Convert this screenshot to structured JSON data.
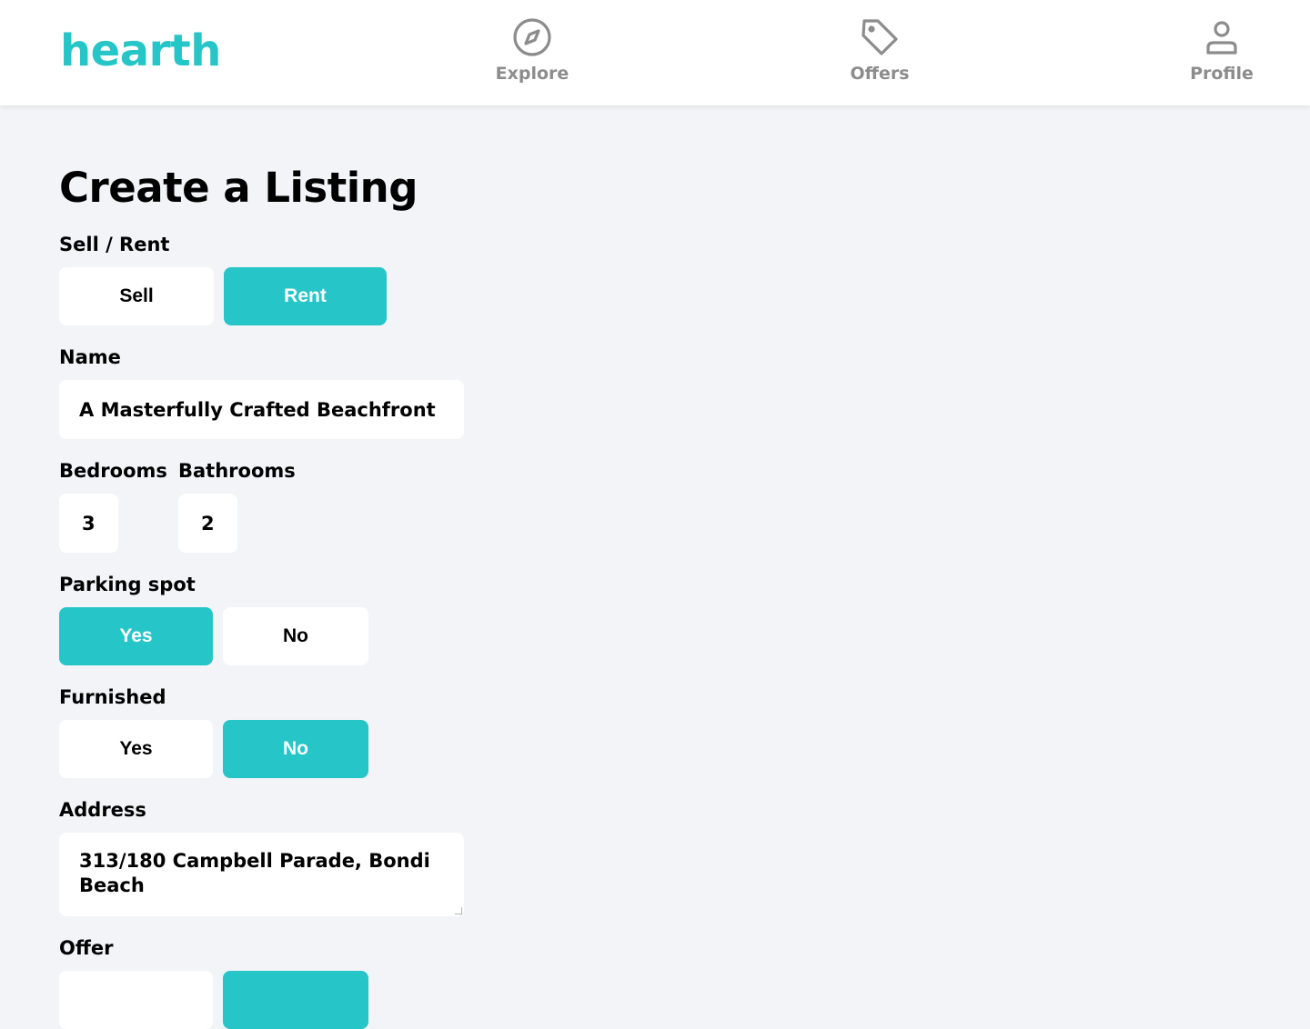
{
  "app": {
    "logo": "hearth",
    "accent_color": "#26c6c8"
  },
  "nav": {
    "explore": {
      "label": "Explore",
      "icon": "compass-icon"
    },
    "offers": {
      "label": "Offers",
      "icon": "tag-icon"
    },
    "profile": {
      "label": "Profile",
      "icon": "user-icon"
    }
  },
  "form": {
    "title": "Create a Listing",
    "sell_rent": {
      "label": "Sell / Rent",
      "options": [
        "Sell",
        "Rent"
      ],
      "selected": "Rent"
    },
    "name": {
      "label": "Name",
      "value": "A Masterfully Crafted Beachfront"
    },
    "bedrooms": {
      "label": "Bedrooms",
      "value": "3"
    },
    "bathrooms": {
      "label": "Bathrooms",
      "value": "2"
    },
    "parking": {
      "label": "Parking spot",
      "options": [
        "Yes",
        "No"
      ],
      "selected": "Yes"
    },
    "furnished": {
      "label": "Furnished",
      "options": [
        "Yes",
        "No"
      ],
      "selected": "No"
    },
    "address": {
      "label": "Address",
      "value_line1": "313/180 Campbell Parade, Bondi",
      "value_line2": "Beach"
    },
    "offer": {
      "label": "Offer"
    }
  }
}
